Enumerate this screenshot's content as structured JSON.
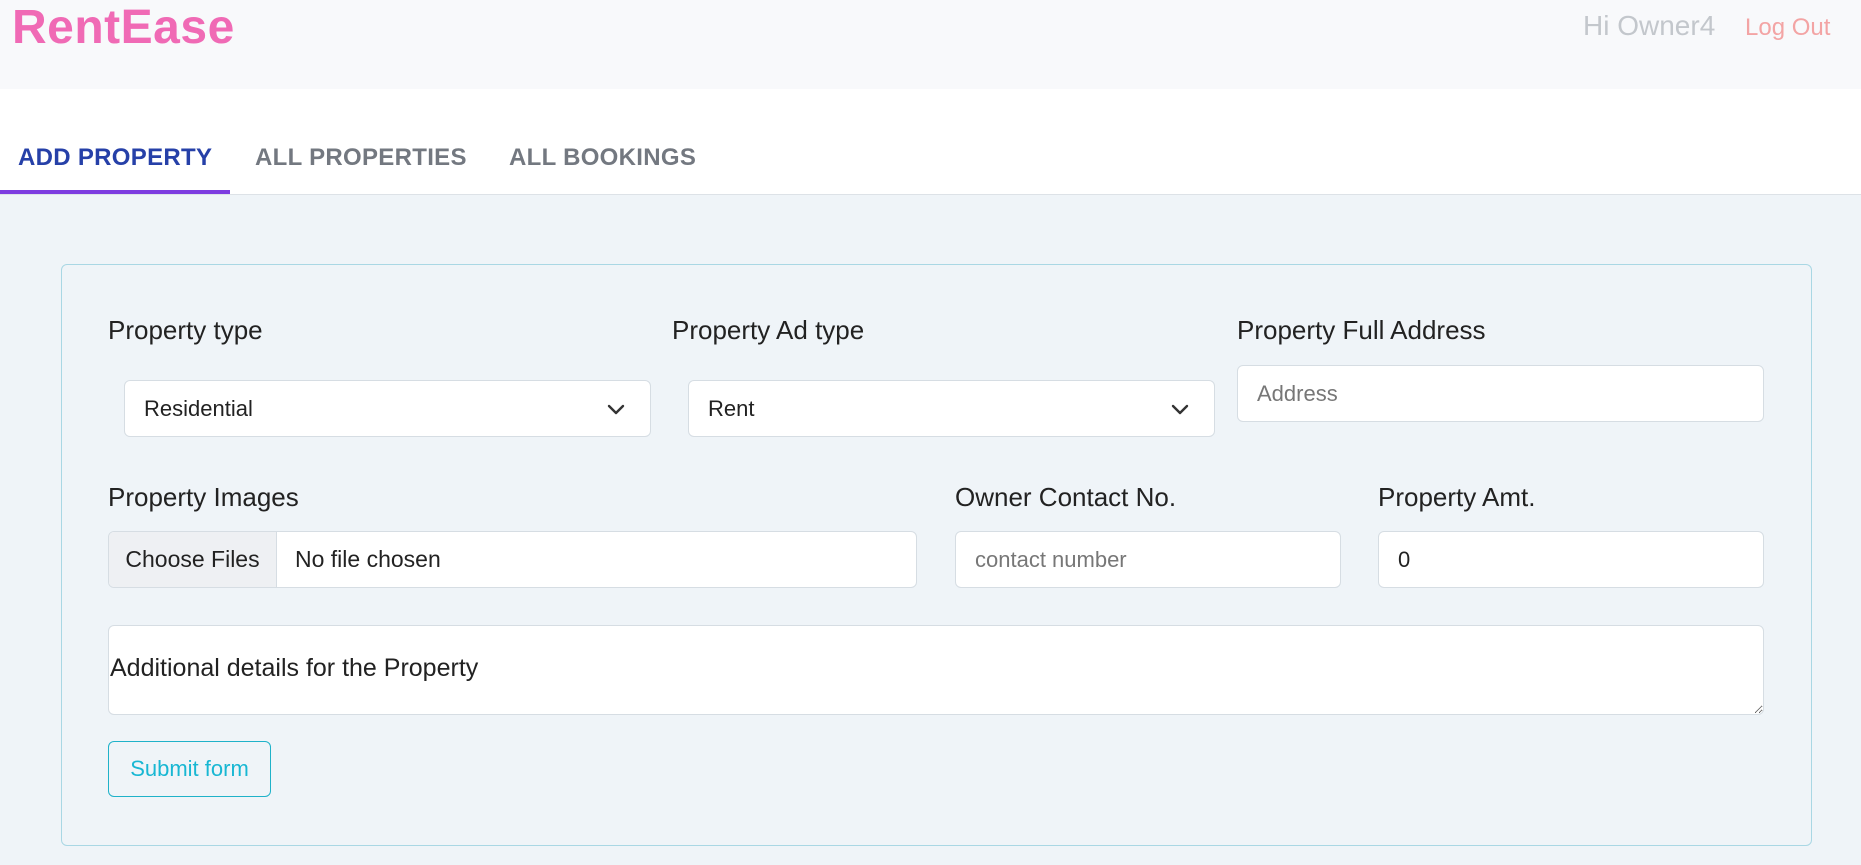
{
  "app": {
    "brand": "RentEase"
  },
  "header": {
    "greeting": "Hi Owner4",
    "logout_label": "Log Out"
  },
  "tabs": [
    {
      "label": "ADD PROPERTY",
      "active": true
    },
    {
      "label": "ALL PROPERTIES",
      "active": false
    },
    {
      "label": "ALL BOOKINGS",
      "active": false
    }
  ],
  "form": {
    "property_type": {
      "label": "Property type",
      "value": "Residential"
    },
    "ad_type": {
      "label": "Property Ad type",
      "value": "Rent"
    },
    "address": {
      "label": "Property Full Address",
      "placeholder": "Address"
    },
    "images": {
      "label": "Property Images",
      "button": "Choose Files",
      "status": "No file chosen"
    },
    "contact": {
      "label": "Owner Contact No.",
      "placeholder": "contact number"
    },
    "amount": {
      "label": "Property Amt.",
      "value": "0"
    },
    "details": {
      "placeholder": "Additional details for the Property"
    },
    "submit_label": "Submit form"
  },
  "icons": {
    "select_arrow": "chevron-down-icon"
  },
  "colors": {
    "brand": "#f06ab5",
    "active_tab": "#2640a8",
    "tab_indicator": "#7d3ce0",
    "submit": "#18b7d3"
  }
}
